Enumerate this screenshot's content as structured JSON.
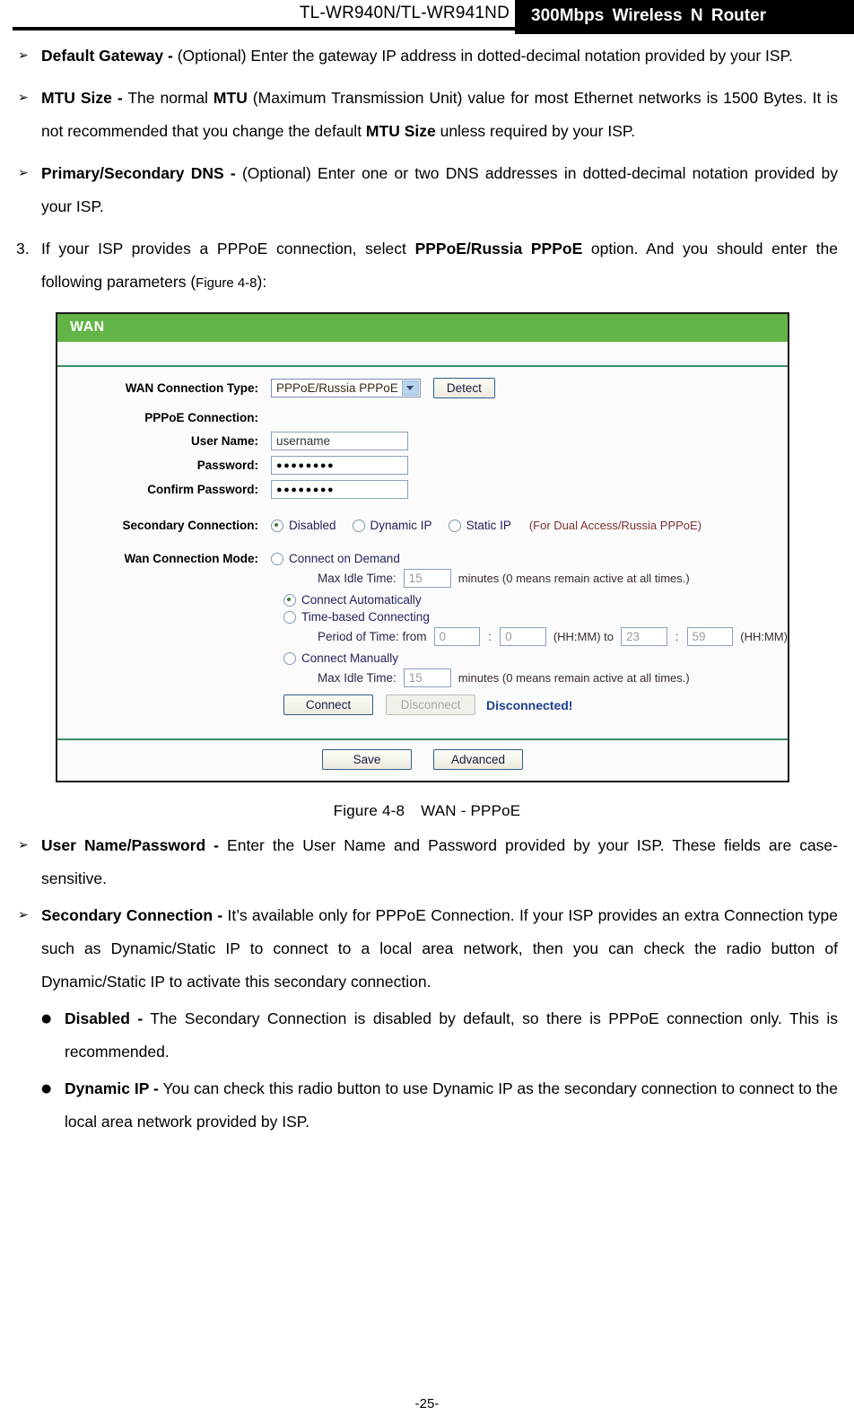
{
  "header": {
    "model": "TL-WR940N/TL-WR941ND",
    "tagline": "300Mbps Wireless N Router"
  },
  "body_text": {
    "b1": {
      "term": "Default Gateway -",
      "rest": " (Optional) Enter the gateway IP address in dotted-decimal notation provided by your ISP."
    },
    "b2": {
      "term": "MTU Size -",
      "p1": " The normal ",
      "term2": "MTU",
      "p2": " (Maximum Transmission Unit) value for most Ethernet networks is 1500 Bytes. It is not recommended that you change the default ",
      "term3": "MTU Size",
      "p3": " unless required by your ISP."
    },
    "b3": {
      "term": "Primary/Secondary DNS -",
      "rest": " (Optional) Enter one or two DNS addresses in dotted-decimal notation provided by your ISP."
    },
    "step3": {
      "number": "3.",
      "p1": "If your ISP provides a PPPoE connection, select ",
      "term": "PPPoE/Russia PPPoE",
      "p2": " option. And you should enter the following parameters (",
      "figref": "Figure 4-8",
      "p3": "):"
    },
    "b4": {
      "term": "User Name/Password -",
      "rest": " Enter the User Name and Password provided by your ISP. These fields are case-sensitive."
    },
    "b5": {
      "term": "Secondary Connection -",
      "rest": " It’s available only for PPPoE Connection. If your ISP provides an extra Connection type such as Dynamic/Static IP to connect to a local area network, then you can check the radio button of Dynamic/Static IP to activate this secondary connection."
    },
    "b6": {
      "term": "Disabled -",
      "rest": " The Secondary Connection is disabled by default, so there is PPPoE connection only. This is recommended."
    },
    "b7": {
      "term": "Dynamic IP -",
      "rest": " You can check this radio button to use Dynamic IP as the secondary connection to connect to the local area network provided by ISP."
    },
    "markers": {
      "arrow": "➢",
      "dot": "●"
    }
  },
  "figure": {
    "caption_label": "Figure 4-8",
    "caption_text": "WAN - PPPoE",
    "panel": {
      "title": "WAN",
      "wan_connection_type": {
        "label": "WAN Connection Type:",
        "selected": "PPPoE/Russia PPPoE",
        "detect_button": "Detect"
      },
      "pppoe_connection_label": "PPPoE Connection:",
      "user_name": {
        "label": "User Name:",
        "value": "username"
      },
      "password": {
        "label": "Password:",
        "value": "●●●●●●●●"
      },
      "confirm_password": {
        "label": "Confirm Password:",
        "value": "●●●●●●●●"
      },
      "secondary_connection": {
        "label": "Secondary Connection:",
        "options": [
          "Disabled",
          "Dynamic IP",
          "Static IP"
        ],
        "selected": "Disabled",
        "note": "(For Dual Access/Russia PPPoE)"
      },
      "wan_connection_mode": {
        "label": "Wan Connection Mode:",
        "connect_on_demand": {
          "option": "Connect on Demand",
          "max_idle_label": "Max Idle Time:",
          "max_idle_value": "15",
          "max_idle_suffix": "minutes (0 means remain active at all times.)"
        },
        "connect_automatically": {
          "option": "Connect Automatically"
        },
        "time_based": {
          "option": "Time-based Connecting",
          "period_label": "Period of Time: from",
          "from_hh": "0",
          "from_mm": "0",
          "mid_label": "(HH:MM) to",
          "to_hh": "23",
          "to_mm": "59",
          "end_label": "(HH:MM)",
          "colon": ":"
        },
        "connect_manually": {
          "option": "Connect Manually",
          "max_idle_label": "Max Idle Time:",
          "max_idle_value": "15",
          "max_idle_suffix": "minutes (0 means remain active at all times.)"
        },
        "selected": "Connect Automatically",
        "connect_button": "Connect",
        "disconnect_button": "Disconnect",
        "status": "Disconnected!"
      },
      "save_button": "Save",
      "advanced_button": "Advanced"
    }
  },
  "footer": {
    "page_number": "-25-"
  },
  "colors": {
    "panel_title_green": "#62b546",
    "divider_green": "#3f8c62",
    "status_blue": "#1c3f8f",
    "note_red": "#7a3030"
  }
}
